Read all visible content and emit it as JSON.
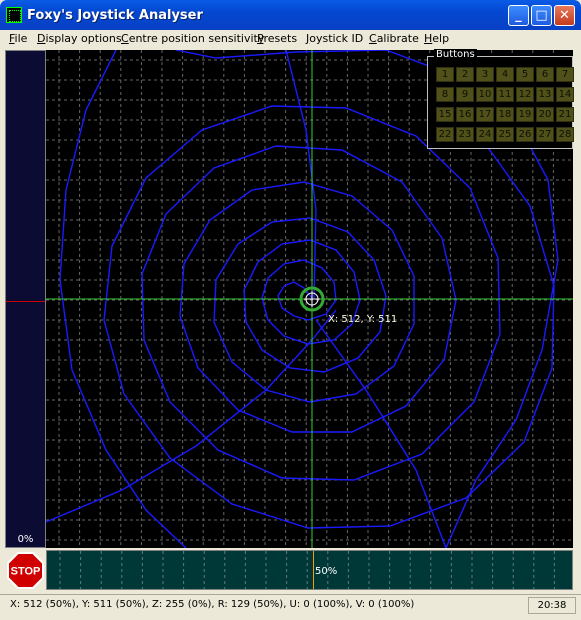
{
  "window": {
    "title": "Foxy's Joystick Analyser"
  },
  "menu": [
    "File",
    "Display options",
    "Centre position sensitivity",
    "Presets",
    "Joystick ID",
    "Calibrate",
    "Help"
  ],
  "left_meter": {
    "percent_label": "0%"
  },
  "buttons_panel": {
    "legend": "Buttons",
    "buttons": [
      "1",
      "2",
      "3",
      "4",
      "5",
      "6",
      "7",
      "8",
      "9",
      "10",
      "11",
      "12",
      "13",
      "14",
      "15",
      "16",
      "17",
      "18",
      "19",
      "20",
      "21",
      "22",
      "23",
      "24",
      "25",
      "26",
      "27",
      "28"
    ]
  },
  "plot": {
    "coord_label": "X: 512, Y: 511",
    "crosshair_color": "#33cc33",
    "trace_color": "#1a1aff"
  },
  "stop_button": {
    "label": "STOP"
  },
  "bottom_meter": {
    "percent_label": "50%"
  },
  "statusbar": {
    "text": "X: 512 (50%), Y: 511 (50%), Z: 255 (0%), R: 129 (50%), U: 0 (100%), V: 0 (100%)",
    "clock": "20:38"
  }
}
